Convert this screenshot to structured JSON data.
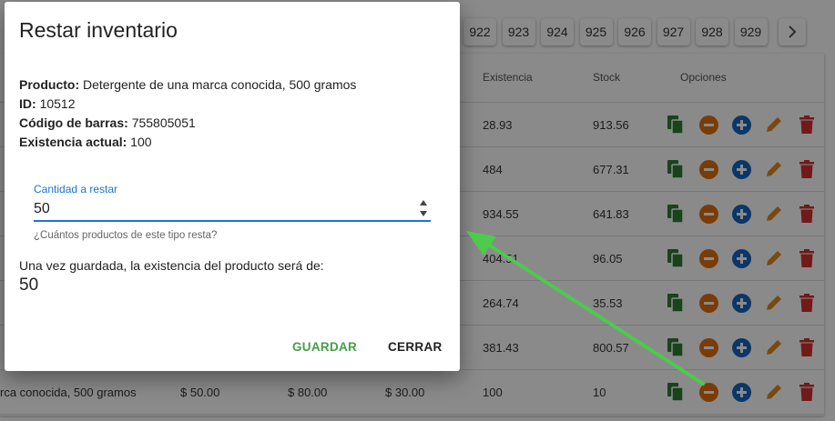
{
  "pagination": {
    "pages": [
      "922",
      "923",
      "924",
      "925",
      "926",
      "927",
      "928",
      "929"
    ],
    "next_label": "›"
  },
  "table": {
    "headers": {
      "existencia": "Existencia",
      "stock": "Stock",
      "opciones": "Opciones"
    },
    "rows": [
      {
        "existencia": "28.93",
        "stock": "913.56"
      },
      {
        "existencia": "484",
        "stock": "677.31"
      },
      {
        "existencia": "934.55",
        "stock": "641.83"
      },
      {
        "existencia": "404.51",
        "stock": "96.05"
      },
      {
        "existencia": "264.74",
        "stock": "35.53"
      },
      {
        "existencia": "381.43",
        "stock": "800.57"
      },
      {
        "nombre": "rca conocida, 500 gramos",
        "precio1": "$ 50.00",
        "precio2": "$ 80.00",
        "precio3": "$ 30.00",
        "existencia": "100",
        "stock": "10"
      }
    ],
    "option_icons": [
      "copy-icon",
      "minus-circle-icon",
      "plus-circle-icon",
      "pencil-icon",
      "trash-icon"
    ],
    "colors": {
      "copy": "#2e7d32",
      "minus": "#e07010",
      "plus": "#1565c0",
      "pencil": "#e08a1e",
      "trash": "#d32f2f"
    }
  },
  "dialog": {
    "title": "Restar inventario",
    "product_label": "Producto:",
    "product_value": "Detergente de una marca conocida, 500 gramos",
    "id_label": "ID:",
    "id_value": "10512",
    "barcode_label": "Código de barras:",
    "barcode_value": "755805051",
    "stock_label": "Existencia actual:",
    "stock_value": "100",
    "field_label": "Cantidad a restar",
    "field_value": "50",
    "field_hint": "¿Cuántos productos de este tipo resta?",
    "result_label": "Una vez guardada, la existencia del producto será de:",
    "result_value": "50",
    "save_label": "GUARDAR",
    "close_label": "CERRAR",
    "colors": {
      "accent": "#1976d2",
      "save": "#43a047"
    }
  },
  "annotation": {
    "arrow_color": "#4ccb4c"
  }
}
